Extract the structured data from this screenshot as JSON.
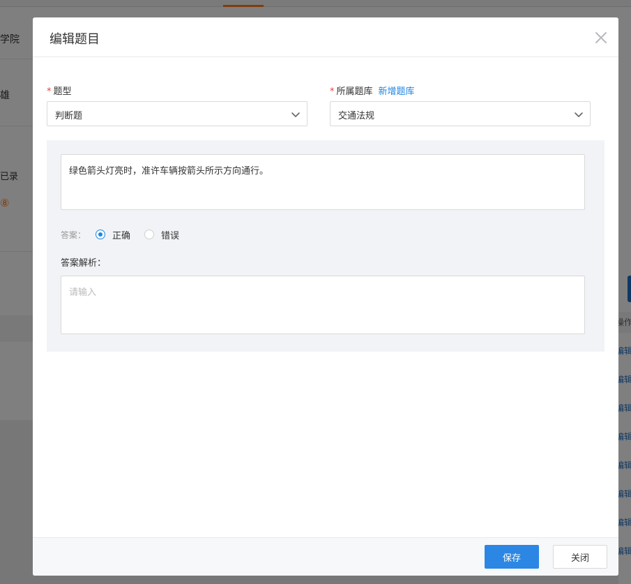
{
  "background": {
    "left_items": [
      "学院",
      "雄",
      "已录",
      "⑧"
    ],
    "right_header": "操作",
    "right_links": [
      "编辑",
      "编辑",
      "编辑",
      "编辑",
      "编辑",
      "编辑",
      "编辑",
      "编辑"
    ]
  },
  "modal": {
    "title": "编辑题目",
    "fields": {
      "type": {
        "required_mark": "*",
        "label": "题型",
        "value": "判断题"
      },
      "bank": {
        "required_mark": "*",
        "label": "所属题库",
        "link": "新增题库",
        "value": "交通法规"
      }
    },
    "question": "绿色箭头灯亮时，准许车辆按箭头所示方向通行。",
    "answer": {
      "label": "答案：",
      "options": [
        "正确",
        "错误"
      ],
      "selected": "正确"
    },
    "analysis": {
      "label": "答案解析：",
      "placeholder": "请输入"
    },
    "footer": {
      "save_label": "保存",
      "close_label": "关闭"
    }
  },
  "colors": {
    "accent": "#1f86e0",
    "primary_button": "#2b87e3",
    "required": "#e64242"
  }
}
